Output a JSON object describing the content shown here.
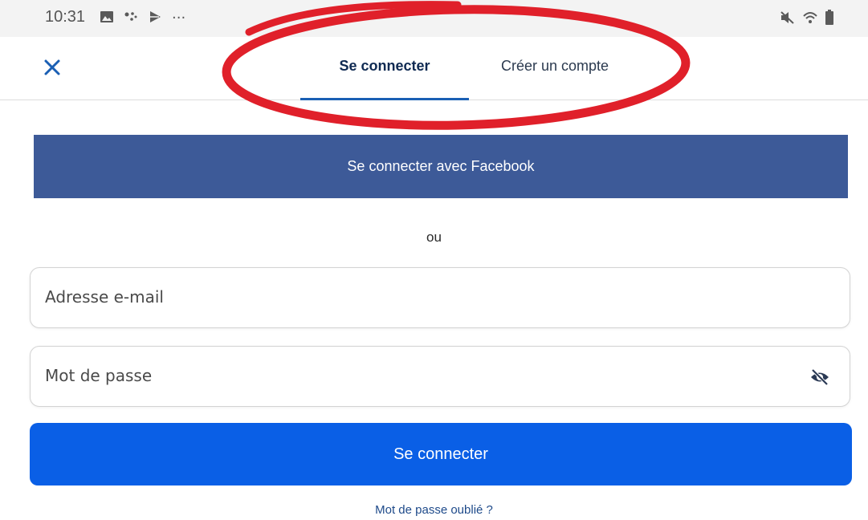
{
  "status_bar": {
    "time": "10:31",
    "more": "···",
    "icons_left": [
      "image-icon",
      "dots-icon",
      "play-store-icon"
    ],
    "icons_right": [
      "mute-icon",
      "wifi-icon",
      "battery-icon"
    ]
  },
  "header": {
    "close_icon": "close-icon",
    "tabs": [
      {
        "label": "Se connecter",
        "active": true
      },
      {
        "label": "Créer un compte",
        "active": false
      }
    ]
  },
  "facebook": {
    "label": "Se connecter avec Facebook",
    "color": "#3d5a98"
  },
  "separator": {
    "label": "ou"
  },
  "form": {
    "email_placeholder": "Adresse e-mail",
    "password_placeholder": "Mot de passe",
    "password_toggle_icon": "eye-off-icon",
    "submit_label": "Se connecter",
    "submit_color": "#0a5fe6",
    "forgot_label": "Mot de passe oublié ?"
  },
  "annotation": {
    "shape": "ellipse",
    "color": "#e0202a"
  }
}
